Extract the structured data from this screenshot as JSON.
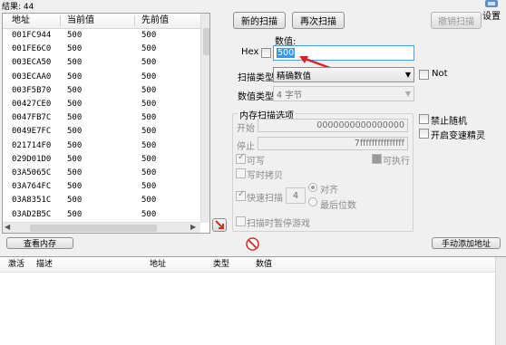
{
  "results_label": "結果: 44",
  "settings_label": "设置",
  "address_list": {
    "columns": [
      "地址",
      "当前值",
      "先前值"
    ],
    "rows": [
      {
        "addr": "001FC944",
        "cur": "500",
        "prev": "500"
      },
      {
        "addr": "001FE6C0",
        "cur": "500",
        "prev": "500"
      },
      {
        "addr": "003ECA50",
        "cur": "500",
        "prev": "500"
      },
      {
        "addr": "003ECAA0",
        "cur": "500",
        "prev": "500"
      },
      {
        "addr": "003F5B70",
        "cur": "500",
        "prev": "500"
      },
      {
        "addr": "00427CE0",
        "cur": "500",
        "prev": "500"
      },
      {
        "addr": "0047FB7C",
        "cur": "500",
        "prev": "500"
      },
      {
        "addr": "0049E7FC",
        "cur": "500",
        "prev": "500"
      },
      {
        "addr": "021714F0",
        "cur": "500",
        "prev": "500"
      },
      {
        "addr": "029D01D0",
        "cur": "500",
        "prev": "500"
      },
      {
        "addr": "03A5065C",
        "cur": "500",
        "prev": "500"
      },
      {
        "addr": "03A764FC",
        "cur": "500",
        "prev": "500"
      },
      {
        "addr": "03A8351C",
        "cur": "500",
        "prev": "500"
      },
      {
        "addr": "03AD2B5C",
        "cur": "500",
        "prev": "500"
      }
    ]
  },
  "buttons": {
    "new_scan": "新的扫描",
    "next_scan": "再次扫描",
    "undo_scan": "撤销扫描",
    "view_memory": "查看内存",
    "add_address": "手动添加地址"
  },
  "value": {
    "label": "数值:",
    "hex_label": "Hex",
    "input": "500"
  },
  "scan_type": {
    "label": "扫描类型",
    "selected": "精确数值"
  },
  "value_type": {
    "label": "数值类型",
    "selected": "4 字节"
  },
  "not_label": "Not",
  "memory_options": {
    "title": "内存扫描选项",
    "start_label": "开始",
    "start_value": "0000000000000000",
    "stop_label": "停止",
    "stop_value": "7fffffffffffffff",
    "writable": "可写",
    "executable": "可执行",
    "copy_on_write": "写时拷贝",
    "fast_scan": "快速扫描",
    "fast_scan_value": "4",
    "align": "对齐",
    "last_digits": "最后位数",
    "pause_game": "扫描时暂停游戏"
  },
  "disable_random": "禁止随机",
  "speedhack": "开启变速精灵",
  "bottom_columns": [
    "激活",
    "描述",
    "地址",
    "类型",
    "数值"
  ]
}
